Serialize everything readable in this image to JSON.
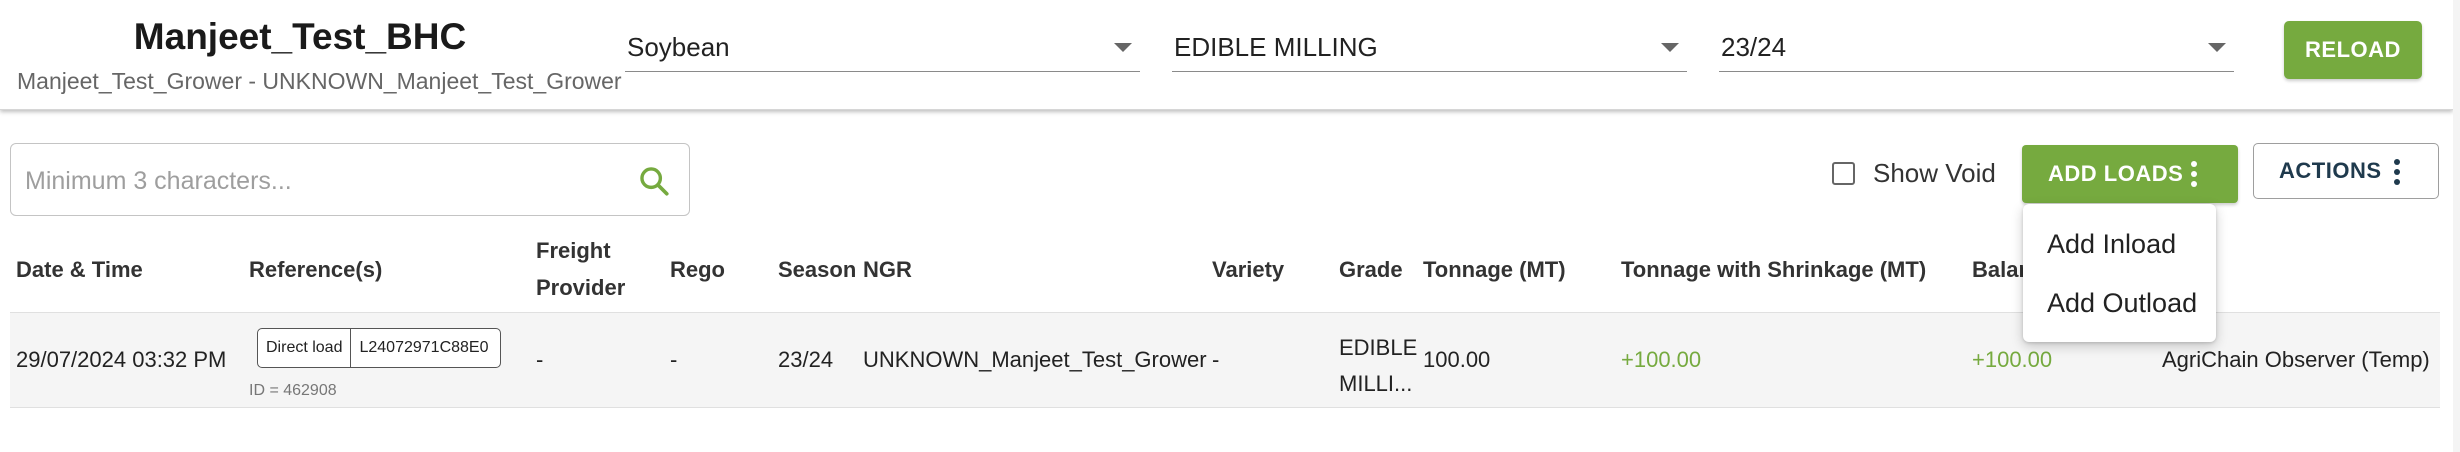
{
  "header": {
    "site_name": "Manjeet_Test_BHC",
    "site_subtitle": "Manjeet_Test_Grower - UNKNOWN_Manjeet_Test_Grower",
    "commodity": "Soybean",
    "grade": "EDIBLE MILLING",
    "season": "23/24",
    "reload_label": "RELOAD"
  },
  "toolbar": {
    "search_placeholder": "Minimum 3 characters...",
    "show_void_label": "Show Void",
    "show_void_checked": false,
    "add_loads_label": "ADD LOADS",
    "actions_label": "ACTIONS"
  },
  "add_loads_menu": {
    "items": [
      "Add Inload",
      "Add Outload"
    ]
  },
  "table": {
    "headers": {
      "date_time": "Date & Time",
      "references": "Reference(s)",
      "freight_provider_1": "Freight",
      "freight_provider_2": "Provider",
      "rego": "Rego",
      "season": "Season",
      "ngr": "NGR",
      "variety": "Variety",
      "grade": "Grade",
      "tonnage": "Tonnage (MT)",
      "tonnage_shrinkage": "Tonnage with Shrinkage (MT)",
      "balance": "Balar"
    },
    "rows": [
      {
        "date_time": "29/07/2024 03:32 PM",
        "ref_type": "Direct load",
        "ref_number": "L24072971C88E0",
        "ref_id": "ID = 462908",
        "freight_provider": "-",
        "rego": "-",
        "season": "23/24",
        "ngr": "UNKNOWN_Manjeet_Test_Grower",
        "variety": "-",
        "grade_line1": "EDIBLE",
        "grade_line2": "MILLI...",
        "tonnage": "100.00",
        "tonnage_shrinkage": "+100.00",
        "balance": "+100.00",
        "user": "AgriChain Observer (Temp)"
      }
    ]
  },
  "colors": {
    "accent_green": "#76aa3f",
    "actions_text": "#1f3a4d"
  }
}
